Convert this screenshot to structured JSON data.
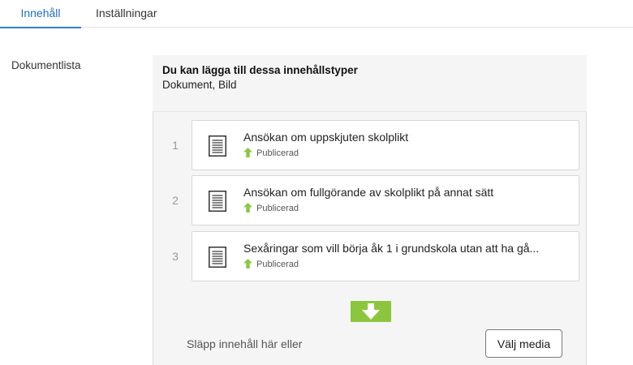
{
  "tabs": [
    {
      "label": "Innehåll",
      "active": true
    },
    {
      "label": "Inställningar",
      "active": false
    }
  ],
  "property": {
    "label": "Dokumentlista"
  },
  "allowed": {
    "title": "Du kan lägga till dessa innehållstyper",
    "types": "Dokument, Bild"
  },
  "items": [
    {
      "number": "1",
      "title": "Ansökan om uppskjuten skolplikt",
      "status": "Publicerad",
      "icon": "document-icon",
      "status_icon": "arrow-up-icon"
    },
    {
      "number": "2",
      "title": "Ansökan om fullgörande av skolplikt på annat sätt",
      "status": "Publicerad",
      "icon": "document-icon",
      "status_icon": "arrow-up-icon"
    },
    {
      "number": "3",
      "title": "Sexåringar som vill börja åk 1 i grundskola utan att ha gå...",
      "status": "Publicerad",
      "icon": "document-icon",
      "status_icon": "arrow-up-icon"
    }
  ],
  "drop": {
    "text": "Släpp innehåll här eller",
    "button_label": "Välj media",
    "icon": "arrow-down-icon"
  },
  "colors": {
    "accent": "#2f7fd8",
    "published": "#8cc63f",
    "drop_button": "#8cc63f"
  }
}
